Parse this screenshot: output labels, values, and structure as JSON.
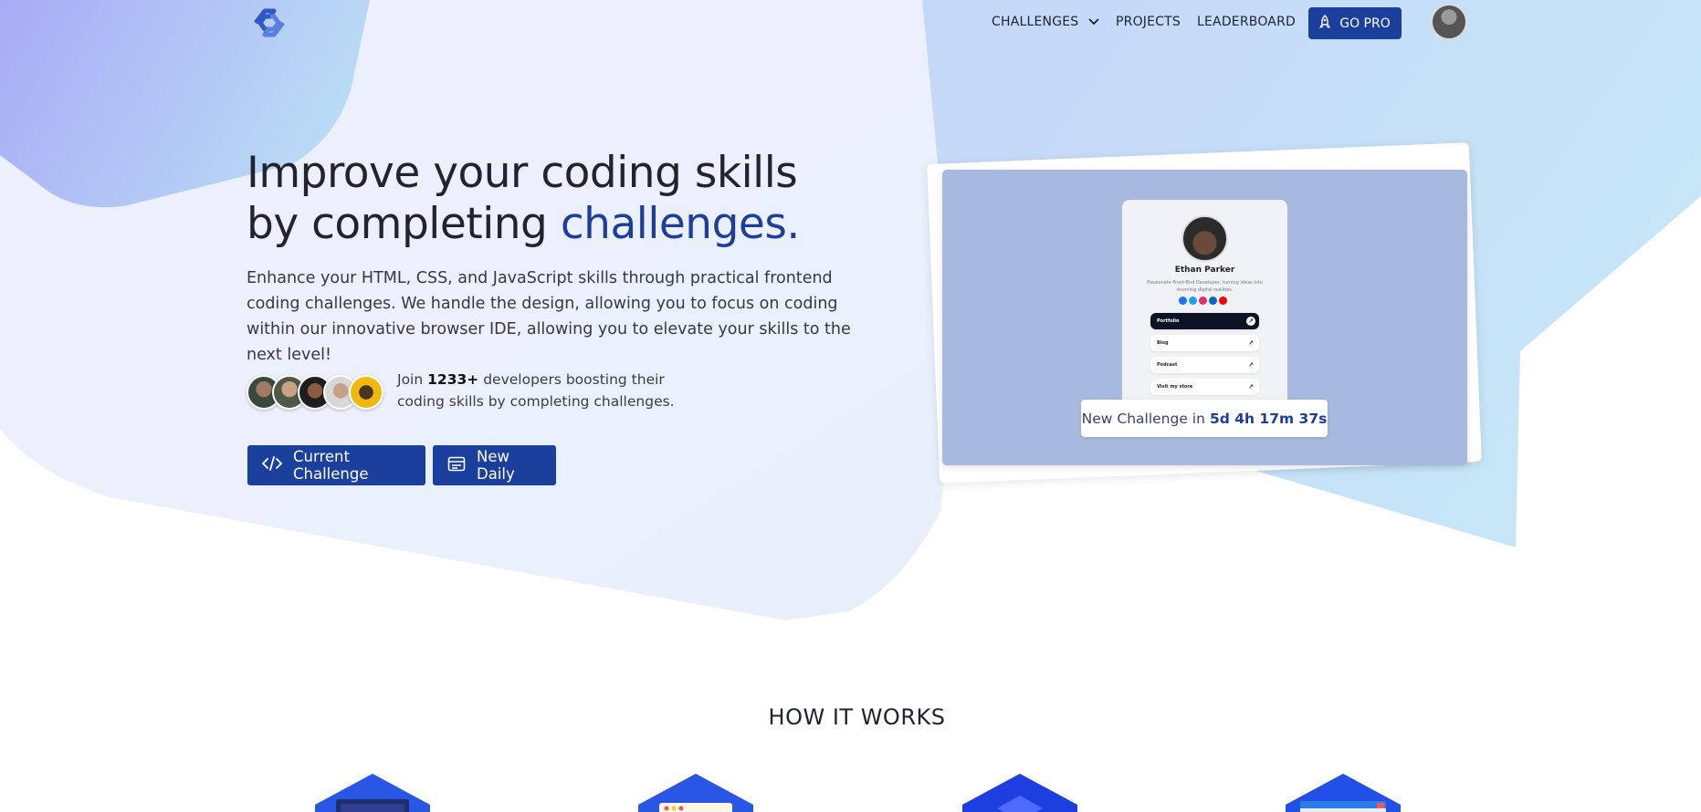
{
  "nav": {
    "logo_icon": "codedex-logo",
    "links": [
      {
        "label": "CHALLENGES",
        "has_dropdown": true
      },
      {
        "label": "PROJECTS"
      },
      {
        "label": "LEADERBOARD"
      }
    ],
    "cta_label": "GO PRO",
    "cta_icon": "rocket-icon",
    "avatar": "user-avatar"
  },
  "hero": {
    "title_line1": "Improve your coding skills",
    "title_line2_prefix": "by completing ",
    "title_line2_accent": "challenges.",
    "description": "Enhance your HTML, CSS, and JavaScript skills through practical frontend coding challenges. We handle the design, allowing you to focus on coding within our innovative browser IDE, allowing you to elevate your skills to the next level!",
    "join_prefix": "Join ",
    "join_count": "1233+",
    "join_suffix_line1": " developers boosting their",
    "join_line2": "coding skills by completing challenges.",
    "buttons": [
      {
        "label": "Current Challenge",
        "icon": "code-icon"
      },
      {
        "label": "New Daily",
        "icon": "calendar-icon"
      }
    ]
  },
  "preview": {
    "profile_name": "Ethan Parker",
    "profile_bio": "Passionate Front-End Developer, turning ideas into stunning digital realities.",
    "links": [
      "Portfolio",
      "Blog",
      "Podcast",
      "Visit my store"
    ],
    "countdown_prefix": "New Challenge in ",
    "countdown_value": "5d 4h 17m 37s"
  },
  "how_it_works": {
    "title": "HOW IT WORKS"
  },
  "colors": {
    "accent": "#1b3f9c",
    "accent_text": "#1d3e9a",
    "card_bg": "#a7b9de"
  }
}
